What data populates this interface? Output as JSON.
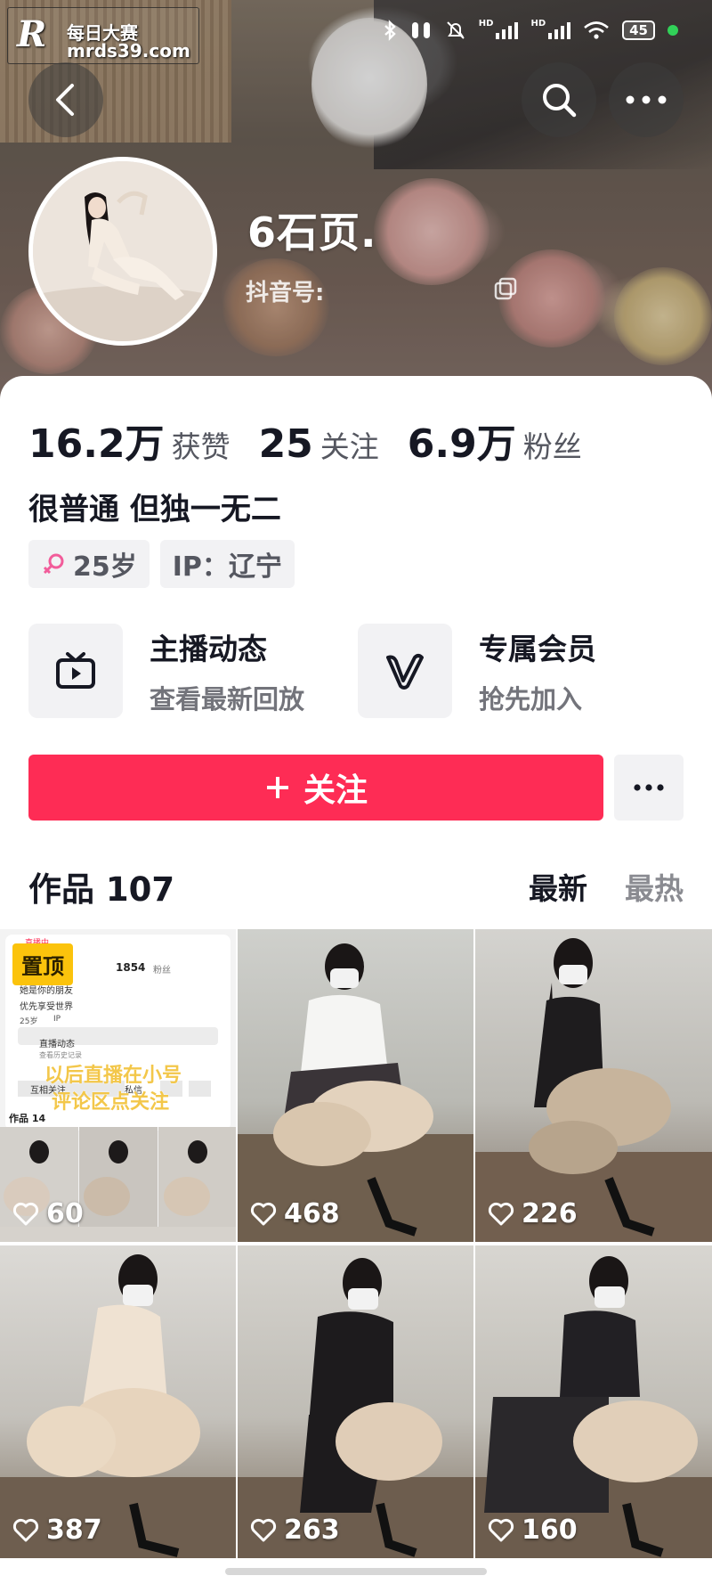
{
  "watermark": {
    "logo": "R",
    "title": "每日大赛",
    "url": "mrds39.com"
  },
  "status_bar": {
    "bluetooth": "bluetooth-icon",
    "battery": "45",
    "network_labels": [
      "HD",
      "HD"
    ]
  },
  "profile": {
    "nickname": "6石页.",
    "douyin_id_label": "抖音号:",
    "stats": [
      {
        "value": "16.2万",
        "label": "获赞"
      },
      {
        "value": "25",
        "label": "关注"
      },
      {
        "value": "6.9万",
        "label": "粉丝"
      }
    ],
    "bio": "很普通 但独一无二",
    "tags": {
      "age": "25岁",
      "ip": "IP：辽宁"
    }
  },
  "features": [
    {
      "title": "主播动态",
      "subtitle": "查看最新回放",
      "icon": "tv-icon"
    },
    {
      "title": "专属会员",
      "subtitle": "抢先加入",
      "icon": "v-member-icon"
    }
  ],
  "actions": {
    "follow_label": "关注"
  },
  "works": {
    "title": "作品 107",
    "tabs": [
      {
        "label": "最新",
        "active": true
      },
      {
        "label": "最热",
        "active": false
      }
    ],
    "items": [
      {
        "likes": "60",
        "pinned": true
      },
      {
        "likes": "468"
      },
      {
        "likes": "226"
      },
      {
        "likes": "387"
      },
      {
        "likes": "263"
      },
      {
        "likes": "160"
      }
    ],
    "pinned_label": "置顶",
    "pinned_preview": {
      "text_overlay_1": "以后直播在小号",
      "text_overlay_2": "评论区点关注",
      "mini_fans": "1854",
      "mini_fans_label": "粉丝",
      "mini_bio": "她是你的朋友",
      "mini_tag": "优先享受世界",
      "mini_age": "25岁",
      "mini_ip": "IP",
      "mini_live": "直播动态",
      "mini_live_sub": "查看历史记录",
      "mini_follow": "互相关注",
      "mini_msg": "私信",
      "mini_works": "作品 14",
      "mini_live_badge": "直播中"
    }
  },
  "colors": {
    "accent": "#fe2c55",
    "pinned": "#fbc30c",
    "text": "#161823",
    "muted": "#73747b"
  }
}
